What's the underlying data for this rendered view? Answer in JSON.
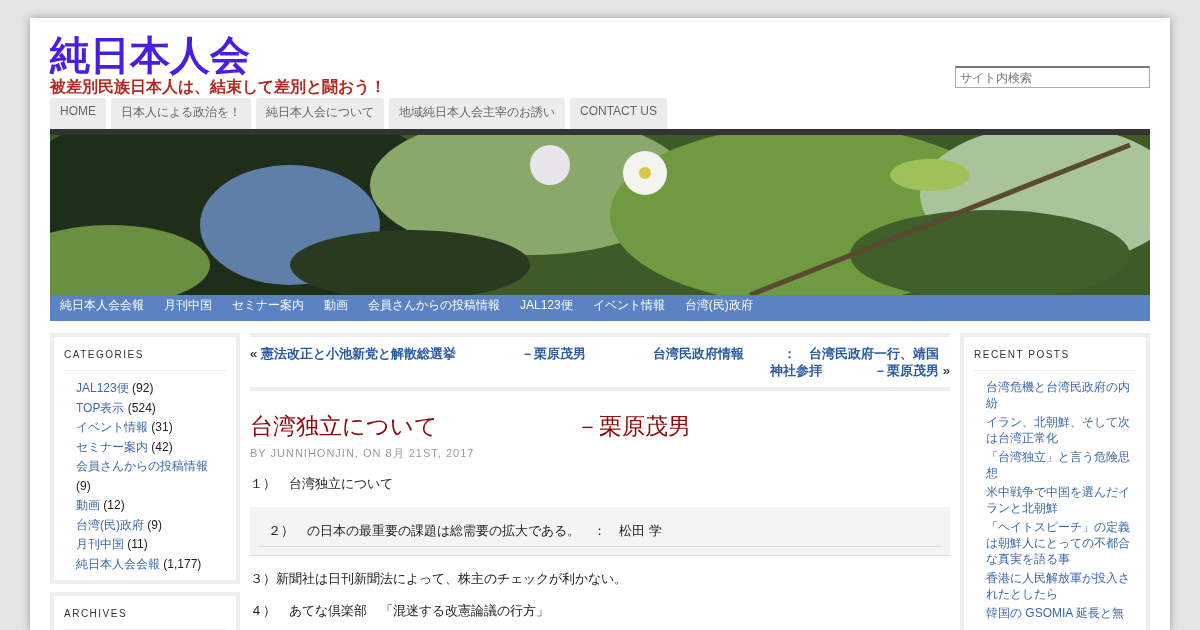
{
  "site": {
    "title": "純日本人会",
    "tagline": "被差別民族日本人は、結束して差別と闘おう！"
  },
  "search": {
    "placeholder": "サイト内検索"
  },
  "top_menu": [
    {
      "label": "HOME"
    },
    {
      "label": "日本人による政治を！"
    },
    {
      "label": "純日本人会について"
    },
    {
      "label": "地域純日本人会主宰のお誘い"
    },
    {
      "label": "CONTACT US"
    }
  ],
  "category_menu": [
    {
      "label": "純日本人会会報"
    },
    {
      "label": "月刊中国"
    },
    {
      "label": "セミナー案内"
    },
    {
      "label": "動画"
    },
    {
      "label": "会員さんからの投稿情報"
    },
    {
      "label": "JAL123便"
    },
    {
      "label": "イベント情報"
    },
    {
      "label": "台湾(民)政府"
    }
  ],
  "categories": {
    "title": "CATEGORIES",
    "items": [
      {
        "label": "JAL123便",
        "count": "(92)"
      },
      {
        "label": "TOP表示",
        "count": "(524)"
      },
      {
        "label": "イベント情報",
        "count": "(31)"
      },
      {
        "label": "セミナー案内",
        "count": "(42)"
      },
      {
        "label": "会員さんからの投稿情報",
        "count": "(9)"
      },
      {
        "label": "動画",
        "count": "(12)"
      },
      {
        "label": "台湾(民)政府",
        "count": "(9)"
      },
      {
        "label": "月刊中国",
        "count": "(11)"
      },
      {
        "label": "純日本人会会報",
        "count": "(1,177)"
      }
    ]
  },
  "archives": {
    "title": "ARCHIVES"
  },
  "post_nav": {
    "prev_mark": "«",
    "prev": "憲法改正と小池新党と解散総選挙　　　　　－栗原茂男",
    "next": "台湾民政府情報　　　：　台湾民政府一行、靖国神社参拝　　　　－栗原茂男",
    "next_mark": "»"
  },
  "post": {
    "title": "台湾独立について　　　　　　－栗原茂男",
    "meta": "BY JUNNIHONJIN, ON 8月 21ST, 2017",
    "lines": [
      {
        "kind": "paragraph",
        "text": "１）　台湾独立について"
      },
      {
        "kind": "quote",
        "text": "２）　の日本の最重要の課題は総需要の拡大である。　：　松田 学"
      },
      {
        "kind": "paragraph",
        "text": "３）新聞社は日刊新聞法によって、株主のチェックが利かない。"
      },
      {
        "kind": "paragraph",
        "text": "４）　あてな倶楽部　「混迷する改憲論議の行方」"
      }
    ]
  },
  "recent_posts": {
    "title": "RECENT POSTS",
    "items": [
      "台湾危機と台湾民政府の内紛",
      "イラン、北朝鮮、そして次は台湾正常化",
      "「台湾独立」と言う危険思想",
      "米中戦争で中国を選んだイランと北朝鮮",
      "「ヘイトスピーチ」の定義は朝鮮人にとっての不都合な真実を語る事",
      "香港に人民解放軍が投入されたとしたら",
      "韓国の GSOMIA 延長と無"
    ]
  }
}
